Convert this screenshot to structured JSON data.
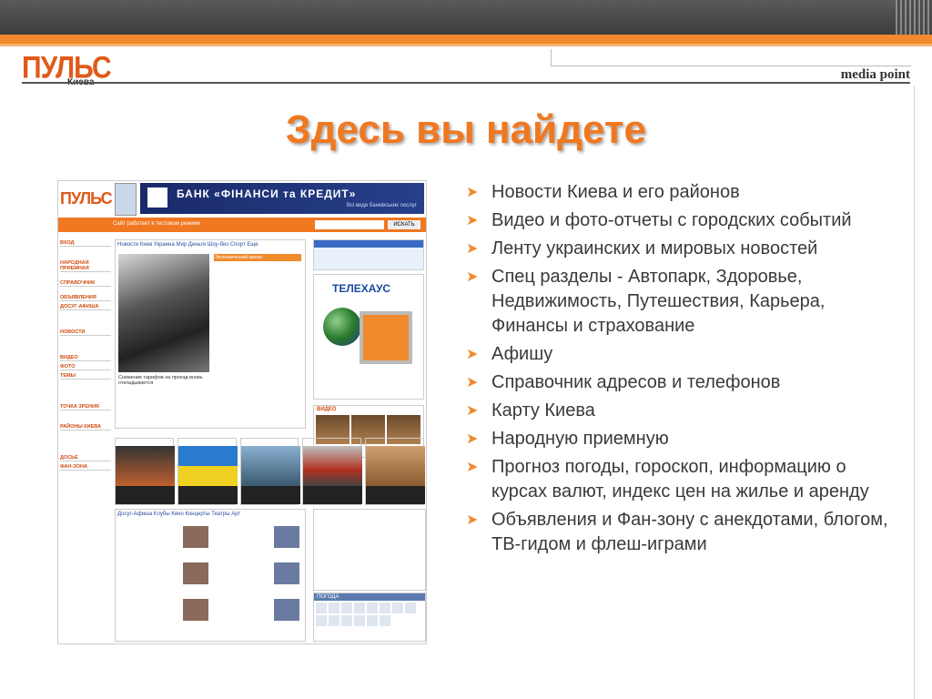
{
  "header": {
    "logo_main": "ПУЛЬС",
    "logo_sub": "Киева",
    "brand": "media point"
  },
  "title": "Здесь вы найдете",
  "bullets": [
    "Новости Киева и его районов",
    "Видео и фото-отчеты с городских событий",
    "Ленту украинских и мировых новостей",
    "Спец разделы - Автопарк, Здоровье, Недвижимость, Путешествия, Карьера, Финансы и страхование",
    "Афишу",
    "Справочник адресов и телефонов",
    "Карту Киева",
    "Народную приемную",
    "Прогноз погоды, гороскоп, информацию о курсах валют, индекс цен на жилье и аренду",
    "Объявления и Фан-зону с анекдотами, блогом, ТВ-гидом и флеш-играми"
  ],
  "screenshot": {
    "logo": "ПУЛЬС",
    "bank_banner": "БАНК «ФІНАНСИ та КРЕДИТ»",
    "bank_sub": "Всі види банківських послуг",
    "top_link": "Сайт работает в тестовом режиме",
    "search_button": "ИСКАТЬ",
    "left_nav": [
      "ВХОД",
      "НАРОДНАЯ ПРИЕМНАЯ",
      "СПРАВОЧНИК",
      "ОБЪЯВЛЕНИЯ",
      "ДОСУГ-АФИША",
      "НОВОСТИ",
      "ВИДЕО",
      "ФОТО",
      "ТЕМЫ",
      "ТОЧКА ЗРЕНИЯ",
      "РАЙОНЫ КИЕВА",
      "ДОСЬЕ",
      "ФАН-ЗОНА"
    ],
    "news_tabs": "Новости  Киев  Украина  Мир  Деньги  Шоу-биз  Спорт  Еще",
    "news_caption": "Снижение тарифов на проезд вновь откладывается",
    "econ_label": "Экономический кризис",
    "tele_brand": "ТЕЛЕХАУС",
    "video_label": "ВИДЕО",
    "afisha_tabs": "Досуг-Афиша  Клубы  Кино  Концерты  Театры  Арт",
    "weather_label": "ПОГОДА"
  }
}
